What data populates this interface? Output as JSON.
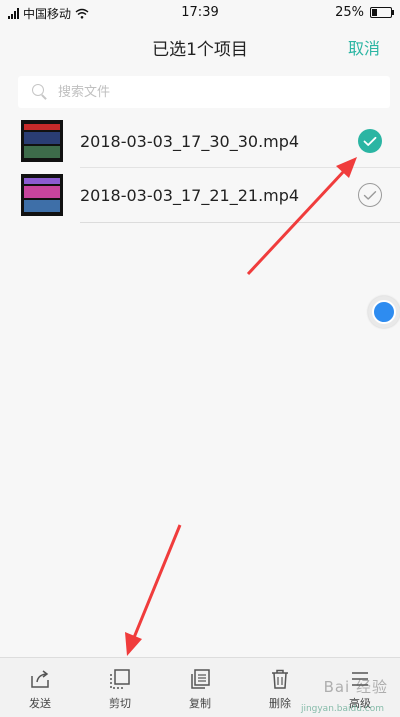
{
  "status_bar": {
    "carrier": "中国移动",
    "time": "17:39",
    "battery": "25%",
    "battery_level": 0.25
  },
  "header": {
    "title": "已选1个项目",
    "cancel_label": "取消"
  },
  "search": {
    "placeholder": "搜索文件"
  },
  "files": [
    {
      "name": "2018-03-03_17_30_30.mp4",
      "selected": true
    },
    {
      "name": "2018-03-03_17_21_21.mp4",
      "selected": false
    }
  ],
  "toolbar": {
    "items": [
      {
        "label": "发送",
        "icon": "share-icon"
      },
      {
        "label": "剪切",
        "icon": "cut-icon"
      },
      {
        "label": "复制",
        "icon": "copy-icon"
      },
      {
        "label": "删除",
        "icon": "trash-icon"
      },
      {
        "label": "高级",
        "icon": "menu-icon"
      }
    ]
  },
  "watermark": "Bai 经验",
  "watermark_sub": "jingyan.baidu.com",
  "colors": {
    "accent": "#2bb5a3",
    "annotation_arrow": "#f03c3c",
    "float_ball": "#2e8cf0"
  }
}
